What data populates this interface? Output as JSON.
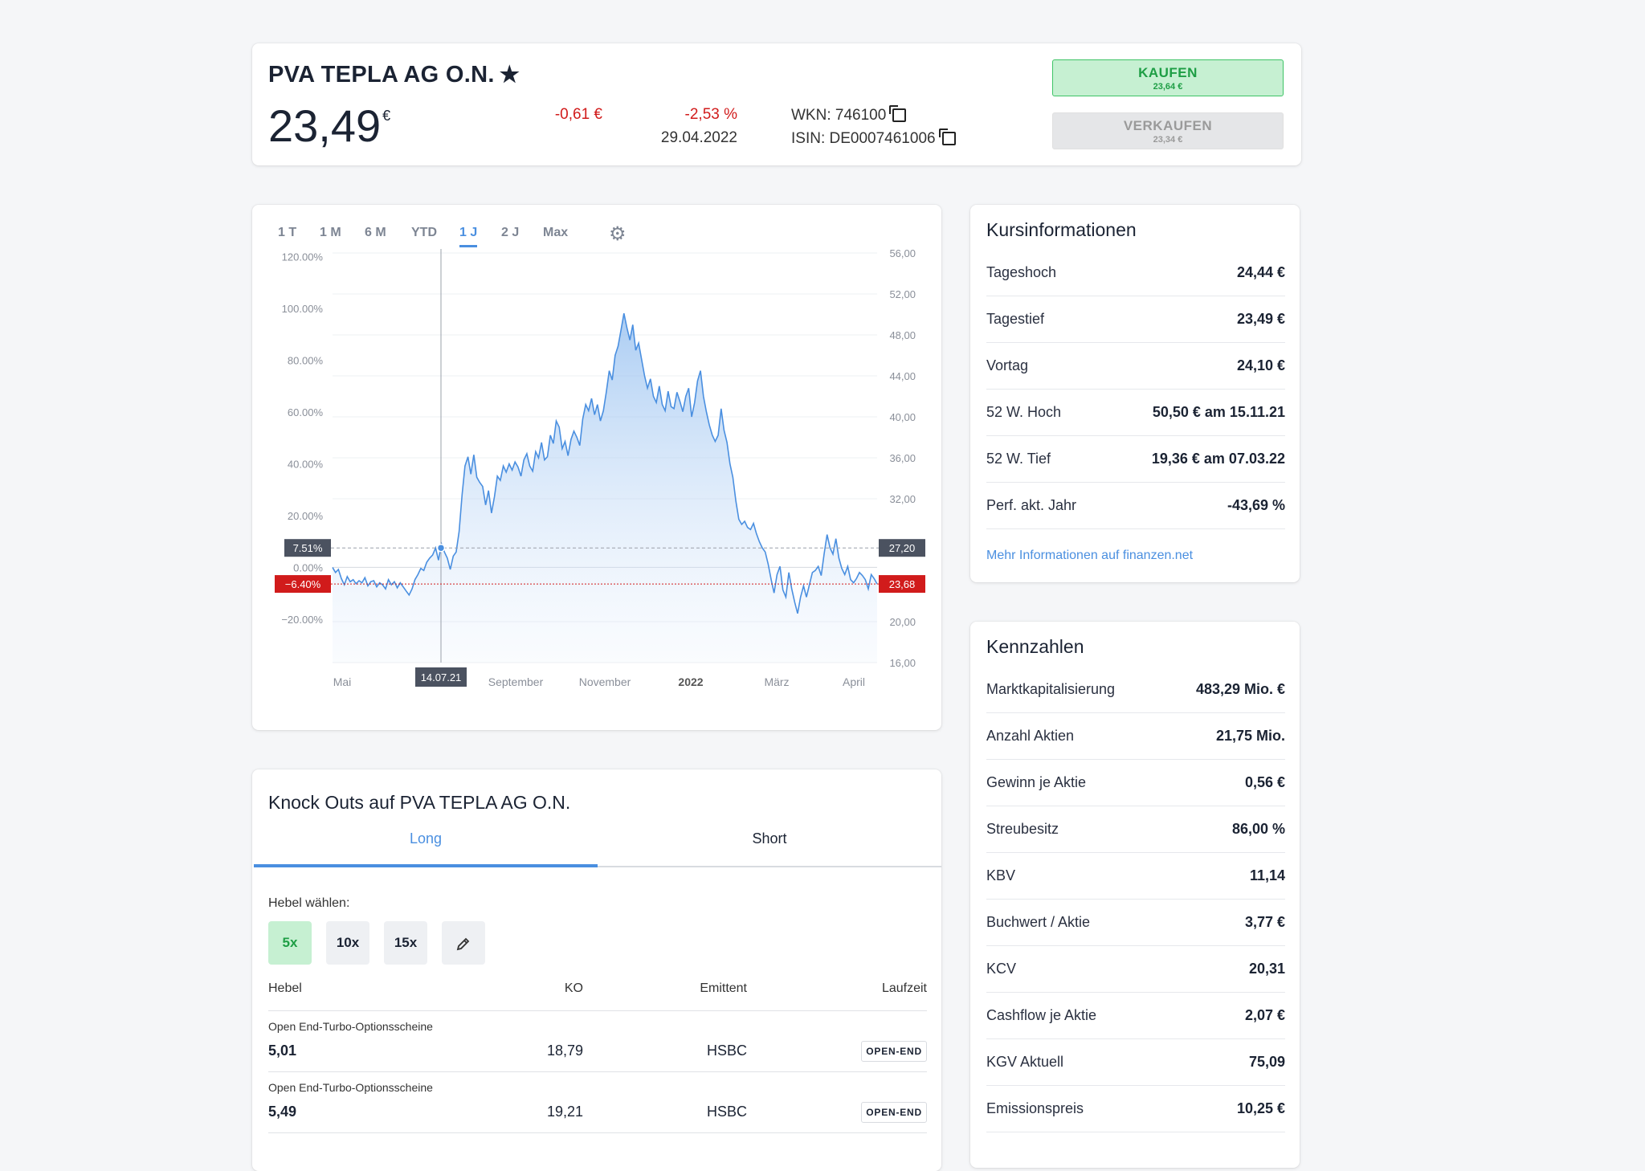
{
  "header": {
    "title": "PVA TEPLA AG O.N.",
    "price": "23,49",
    "price_currency": "€",
    "change_abs": "-0,61 €",
    "change_pct": "-2,53 %",
    "date": "29.04.2022",
    "wkn": "WKN: 746100",
    "isin": "ISIN: DE0007461006",
    "buy_label": "KAUFEN",
    "buy_price": "23,64 €",
    "sell_label": "VERKAUFEN",
    "sell_price": "23,34 €",
    "colors": {
      "negative": "#d11b1b",
      "buy": "#1e9e45",
      "accent": "#4a8fe0"
    }
  },
  "chart": {
    "ranges": [
      "1 T",
      "1 M",
      "6 M",
      "YTD",
      "1 J",
      "2 J",
      "Max"
    ],
    "active_range": "1 J"
  },
  "chart_data": {
    "type": "area",
    "xlabels": [
      "Mai",
      "September",
      "November",
      "2022",
      "März",
      "April"
    ],
    "left_axis_ticks": [
      "120.00%",
      "100.00%",
      "80.00%",
      "60.00%",
      "40.00%",
      "20.00%",
      "0.00%",
      "−20.00%"
    ],
    "right_axis_ticks": [
      "56,00",
      "52,00",
      "48,00",
      "44,00",
      "40,00",
      "36,00",
      "32,00",
      "20,00",
      "16,00"
    ],
    "ylim": [
      16,
      56
    ],
    "crosshair": {
      "date": "14.07.21",
      "pct": "7.51%",
      "price": "27,20",
      "price_value": 27.2
    },
    "current": {
      "pct": "−6.40%",
      "price": "23,68",
      "price_value": 23.68
    },
    "baseline_value": 25.3,
    "series": [
      {
        "values": [
          25.3,
          24.8,
          25.1,
          24.2,
          23.6,
          24.4,
          23.9,
          24.1,
          23.7,
          24.0,
          23.8,
          24.3,
          23.5,
          23.9,
          24.0,
          23.4,
          23.8,
          23.6,
          23.2,
          24.1,
          23.6,
          23.9,
          23.3,
          23.8,
          23.4,
          23.0,
          22.6,
          23.2,
          24.1,
          24.6,
          25.2,
          25.0,
          25.8,
          26.2,
          26.5,
          27.2,
          26.0,
          27.6,
          26.8,
          26.2,
          25.1,
          26.4,
          26.8,
          28.8,
          32.4,
          35.2,
          36.1,
          34.4,
          36.3,
          34.1,
          33.6,
          33.2,
          31.4,
          32.8,
          30.6,
          32.2,
          34.2,
          33.8,
          35.2,
          34.6,
          35.4,
          34.8,
          35.6,
          35.1,
          34.2,
          35.8,
          36.4,
          35.2,
          34.7,
          36.6,
          36.0,
          37.5,
          35.8,
          36.1,
          38.2,
          37.4,
          39.6,
          39.0,
          36.9,
          37.6,
          36.2,
          37.8,
          38.6,
          38.0,
          37.2,
          39.8,
          41.2,
          40.6,
          41.8,
          40.2,
          41.2,
          39.6,
          40.6,
          42.4,
          44.5,
          43.6,
          46.0,
          46.9,
          48.5,
          50.1,
          48.7,
          47.5,
          49.0,
          46.5,
          47.2,
          45.6,
          44.0,
          42.8,
          43.7,
          42.0,
          41.4,
          43.0,
          41.2,
          40.6,
          42.5,
          41.0,
          40.8,
          42.4,
          41.5,
          40.5,
          42.0,
          42.8,
          40.0,
          41.4,
          43.5,
          44.5,
          42.0,
          40.5,
          39.2,
          38.2,
          37.6,
          38.2,
          40.8,
          38.7,
          37.5,
          35.4,
          34.1,
          31.8,
          30.0,
          29.5,
          29.8,
          29.2,
          29.0,
          29.6,
          28.6,
          27.8,
          27.2,
          26.8,
          25.6,
          24.1,
          22.8,
          24.6,
          25.4,
          23.1,
          22.4,
          24.8,
          23.2,
          21.9,
          20.8,
          22.4,
          23.5,
          22.4,
          23.6,
          24.8,
          25.0,
          25.4,
          24.5,
          26.6,
          28.5,
          27.2,
          26.6,
          28.1,
          26.2,
          25.2,
          24.6,
          25.4,
          24.1,
          23.8,
          24.2,
          24.8,
          24.5,
          24.1,
          23.2,
          24.6,
          24.2,
          23.68
        ]
      }
    ]
  },
  "kursinformationen": {
    "title": "Kursinformationen",
    "rows": [
      {
        "k": "Tageshoch",
        "v": "24,44 €"
      },
      {
        "k": "Tagestief",
        "v": "23,49 €"
      },
      {
        "k": "Vortag",
        "v": "24,10 €"
      },
      {
        "k": "52 W. Hoch",
        "v": "50,50 € am 15.11.21"
      },
      {
        "k": "52 W. Tief",
        "v": "19,36 € am 07.03.22"
      },
      {
        "k": "Perf. akt. Jahr",
        "v": "-43,69 %"
      }
    ],
    "link": "Mehr Informationen auf finanzen.net"
  },
  "kennzahlen": {
    "title": "Kennzahlen",
    "rows": [
      {
        "k": "Marktkapitalisierung",
        "v": "483,29 Mio. €"
      },
      {
        "k": "Anzahl Aktien",
        "v": "21,75 Mio."
      },
      {
        "k": "Gewinn je Aktie",
        "v": "0,56 €"
      },
      {
        "k": "Streubesitz",
        "v": "86,00 %"
      },
      {
        "k": "KBV",
        "v": "11,14"
      },
      {
        "k": "Buchwert / Aktie",
        "v": "3,77 €"
      },
      {
        "k": "KCV",
        "v": "20,31"
      },
      {
        "k": "Cashflow je Aktie",
        "v": "2,07 €"
      },
      {
        "k": "KGV Aktuell",
        "v": "75,09"
      },
      {
        "k": "Emissionspreis",
        "v": "10,25 €"
      }
    ]
  },
  "knockouts": {
    "title": "Knock Outs auf PVA TEPLA AG O.N.",
    "tab_long": "Long",
    "tab_short": "Short",
    "hebel_label": "Hebel wählen:",
    "levers": [
      "5x",
      "10x",
      "15x"
    ],
    "columns": {
      "hebel": "Hebel",
      "ko": "KO",
      "emittent": "Emittent",
      "laufzeit": "Laufzeit"
    },
    "rows": [
      {
        "type": "Open End-Turbo-Optionsscheine",
        "hebel": "5,01",
        "ko": "18,79",
        "emittent": "HSBC",
        "laufzeit": "OPEN-END"
      },
      {
        "type": "Open End-Turbo-Optionsscheine",
        "hebel": "5,49",
        "ko": "19,21",
        "emittent": "HSBC",
        "laufzeit": "OPEN-END"
      }
    ]
  }
}
